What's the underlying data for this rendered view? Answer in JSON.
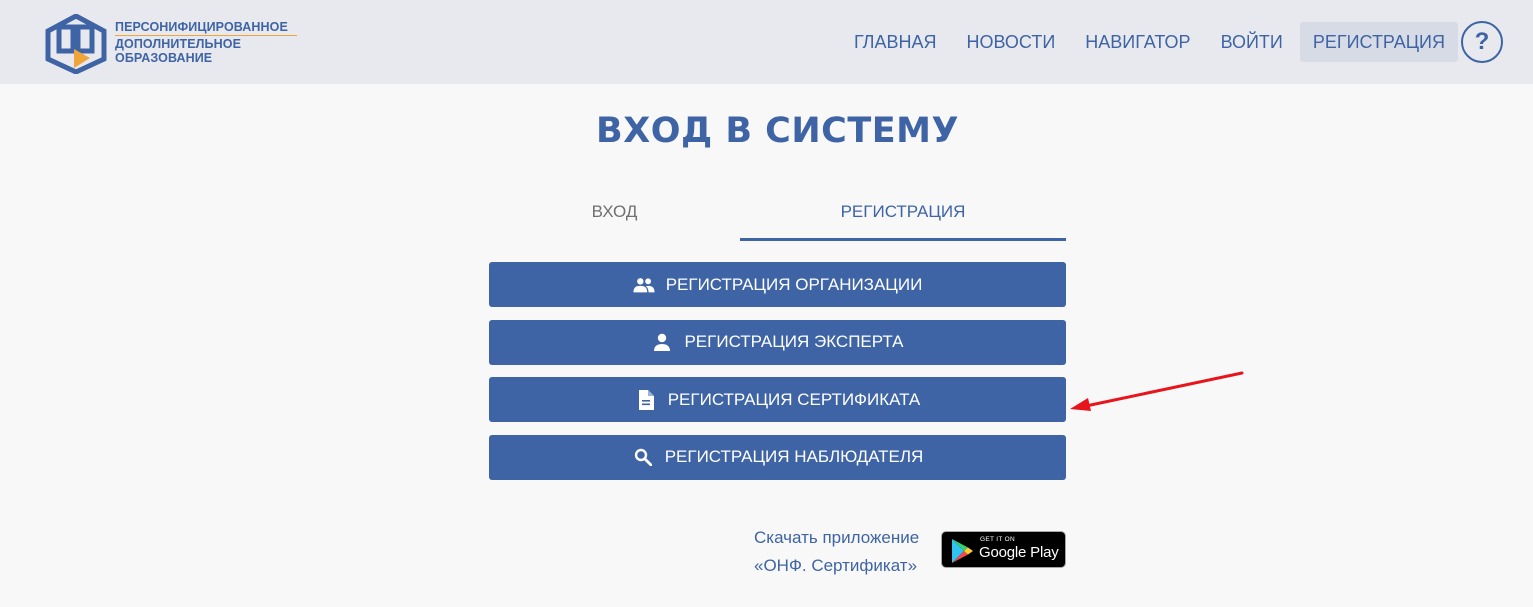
{
  "header": {
    "logo": {
      "line1": "ПЕРСОНИФИЦИРОВАННОЕ",
      "line2": "ДОПОЛНИТЕЛЬНОЕ",
      "line3": "ОБРАЗОВАНИЕ"
    },
    "nav": [
      {
        "label": "ГЛАВНАЯ"
      },
      {
        "label": "НОВОСТИ"
      },
      {
        "label": "НАВИГАТОР"
      },
      {
        "label": "ВОЙТИ"
      },
      {
        "label": "РЕГИСТРАЦИЯ"
      }
    ],
    "help_label": "?"
  },
  "main": {
    "title": "ВХОД В СИСТЕМУ",
    "tabs": [
      {
        "label": "ВХОД"
      },
      {
        "label": "РЕГИСТРАЦИЯ"
      }
    ],
    "actions": [
      {
        "label": "РЕГИСТРАЦИЯ ОРГАНИЗАЦИИ",
        "icon": "group-icon"
      },
      {
        "label": "РЕГИСТРАЦИЯ ЭКСПЕРТА",
        "icon": "person-icon"
      },
      {
        "label": "РЕГИСТРАЦИЯ СЕРТИФИКАТА",
        "icon": "document-icon"
      },
      {
        "label": "РЕГИСТРАЦИЯ НАБЛЮДАТЕЛЯ",
        "icon": "search-icon"
      }
    ]
  },
  "download": {
    "line1": "Скачать приложение",
    "line2": "«ОНФ. Сертификат»",
    "badge_small": "GET IT ON",
    "badge_big": "Google Play"
  },
  "colors": {
    "primary": "#3e64a5",
    "header_bg": "#e8e9ee",
    "accent_orange": "#f0a53a",
    "annotation_arrow": "#e8141c"
  }
}
